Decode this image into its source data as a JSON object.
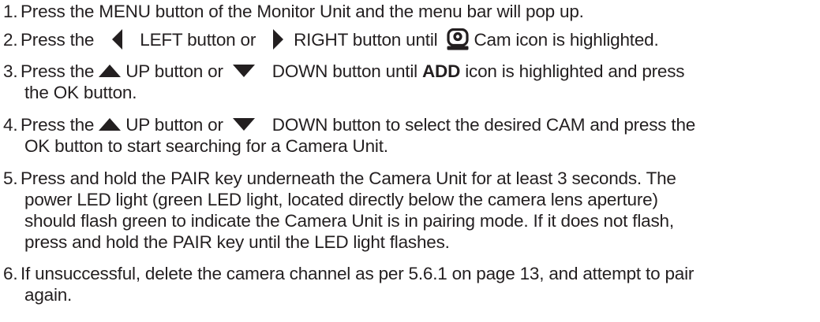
{
  "steps": [
    {
      "number": "1.",
      "lines": [
        {
          "text": "Press the MENU button of the Monitor Unit and the menu bar will pop up."
        }
      ]
    },
    {
      "number": "2.",
      "lines": [
        {
          "t1": "Press the",
          "t2": "LEFT button or",
          "t3": "RIGHT button until",
          "t4": "Cam icon is highlighted."
        }
      ]
    },
    {
      "number": "3.",
      "lines": [
        {
          "t1": "Press the",
          "t2": "UP button or",
          "t3": "DOWN button until",
          "bold": "ADD",
          "t4": "icon is highlighted and press"
        },
        {
          "text": "the OK button."
        }
      ]
    },
    {
      "number": "4.",
      "lines": [
        {
          "t1": "Press the",
          "t2": "UP button or",
          "t3": "DOWN button to select the desired CAM and press the"
        },
        {
          "text": "OK button to start searching for a Camera Unit."
        }
      ]
    },
    {
      "number": "5.",
      "lines": [
        {
          "text": "Press and hold the PAIR key underneath the Camera Unit for at least 3 seconds. The"
        },
        {
          "text": "power LED light (green LED light, located directly below the camera lens aperture)"
        },
        {
          "text": "should flash green to indicate the Camera Unit is in pairing mode. If it does not flash,"
        },
        {
          "text": "press and hold the PAIR key until the LED light flashes."
        }
      ]
    },
    {
      "number": "6.",
      "lines": [
        {
          "text": "If unsuccessful, delete the camera channel as per 5.6.1 on page 13, and attempt to pair"
        },
        {
          "text": "again."
        }
      ]
    }
  ],
  "icons": {
    "left": "left-triangle-icon",
    "right": "right-triangle-icon",
    "cam": "camera-icon",
    "up": "up-triangle-icon",
    "down": "down-triangle-icon"
  },
  "colors": {
    "text": "#231f20"
  }
}
